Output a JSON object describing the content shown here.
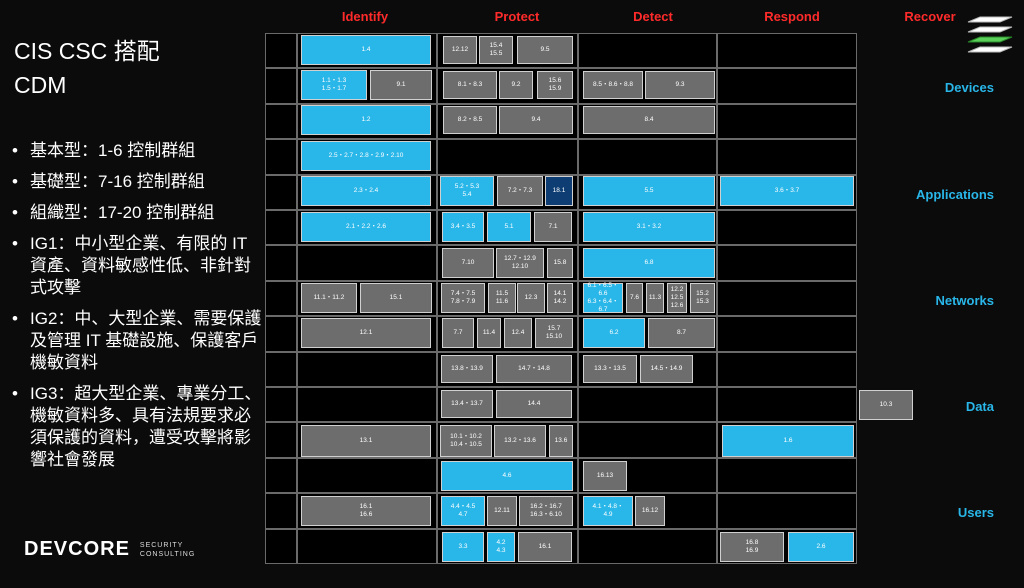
{
  "title": "CIS CSC  搭配\nCDM",
  "bullets": [
    "基本型：1-6 控制群組",
    "基礎型：7-16 控制群組",
    "組織型：17-20 控制群組",
    "IG1：中小型企業、有限的 IT 資產、資料敏感性低、非針對式攻擊",
    "IG2：中、大型企業、需要保護及管理 IT 基礎設施、保護客戶機敏資料",
    "IG3：超大型企業、專業分工、機敏資料多、具有法規要求必須保護的資料，遭受攻擊將影響社會發展"
  ],
  "logo": {
    "name": "DEVCORE",
    "sub": "SECURITY\nCONSULTING"
  },
  "columns": [
    "Identify",
    "Protect",
    "Detect",
    "Respond",
    "Recover"
  ],
  "groups": [
    "Devices",
    "Applications",
    "Networks",
    "Data",
    "Users"
  ],
  "ig_labels": [
    "IG3",
    "IG2",
    "IG1"
  ],
  "colors": {
    "header": "#ff2b2b",
    "group": "#29b6e8",
    "grey": "#6d6d6d",
    "blue": "#29b6e8",
    "dark": "#0d3d73"
  },
  "boxes": [
    {
      "t": "1.4",
      "c": "blue"
    },
    {
      "t": "12.12",
      "c": "grey"
    },
    {
      "t": "15.4\n15.5",
      "c": "grey"
    },
    {
      "t": "9.5",
      "c": "grey"
    },
    {
      "t": "1.1・1.3\n1.5・1.7",
      "c": "blue"
    },
    {
      "t": "9.1",
      "c": "grey"
    },
    {
      "t": "8.1・8.3",
      "c": "grey"
    },
    {
      "t": "9.2",
      "c": "grey"
    },
    {
      "t": "15.6\n15.9",
      "c": "grey"
    },
    {
      "t": "8.5・8.6・8.8",
      "c": "grey"
    },
    {
      "t": "9.3",
      "c": "grey"
    },
    {
      "t": "1.2",
      "c": "blue"
    },
    {
      "t": "8.2・8.5",
      "c": "grey"
    },
    {
      "t": "9.4",
      "c": "grey"
    },
    {
      "t": "8.4",
      "c": "grey"
    },
    {
      "t": "2.5・2.7・2.8・2.9・2.10",
      "c": "blue"
    },
    {
      "t": "2.3・2.4",
      "c": "blue"
    },
    {
      "t": "5.2・5.3\n5.4",
      "c": "blue"
    },
    {
      "t": "7.2・7.3",
      "c": "grey"
    },
    {
      "t": "18.1",
      "c": "dark"
    },
    {
      "t": "5.5",
      "c": "blue"
    },
    {
      "t": "3.6・3.7",
      "c": "blue"
    },
    {
      "t": "2.1・2.2・2.6",
      "c": "blue"
    },
    {
      "t": "3.4・3.5",
      "c": "blue"
    },
    {
      "t": "5.1",
      "c": "blue"
    },
    {
      "t": "7.1",
      "c": "grey"
    },
    {
      "t": "3.1・3.2",
      "c": "blue"
    },
    {
      "t": "7.10",
      "c": "grey"
    },
    {
      "t": "12.7・12.9\n12.10",
      "c": "grey"
    },
    {
      "t": "15.8",
      "c": "grey"
    },
    {
      "t": "6.8",
      "c": "blue"
    },
    {
      "t": "11.1・11.2",
      "c": "grey"
    },
    {
      "t": "15.1",
      "c": "grey"
    },
    {
      "t": "7.4・7.5\n7.8・7.9",
      "c": "grey"
    },
    {
      "t": "11.5\n11.6",
      "c": "grey"
    },
    {
      "t": "12.3",
      "c": "grey"
    },
    {
      "t": "14.1\n14.2",
      "c": "grey"
    },
    {
      "t": "6.1・6.5・6.6\n6.3・6.4・6.7",
      "c": "blue"
    },
    {
      "t": "7.6",
      "c": "grey"
    },
    {
      "t": "11.3",
      "c": "grey"
    },
    {
      "t": "12.2\n12.5\n12.6",
      "c": "grey"
    },
    {
      "t": "15.2\n15.3",
      "c": "grey"
    },
    {
      "t": "12.1",
      "c": "grey"
    },
    {
      "t": "7.7",
      "c": "grey"
    },
    {
      "t": "11.4",
      "c": "grey"
    },
    {
      "t": "12.4",
      "c": "grey"
    },
    {
      "t": "15.7\n15.10",
      "c": "grey"
    },
    {
      "t": "6.2",
      "c": "blue"
    },
    {
      "t": "8.7",
      "c": "grey"
    },
    {
      "t": "13.8・13.9",
      "c": "grey"
    },
    {
      "t": "14.7・14.8",
      "c": "grey"
    },
    {
      "t": "13.3・13.5",
      "c": "grey"
    },
    {
      "t": "14.5・14.9",
      "c": "grey"
    },
    {
      "t": "13.4・13.7",
      "c": "grey"
    },
    {
      "t": "14.4",
      "c": "grey"
    },
    {
      "t": "10.3",
      "c": "grey"
    },
    {
      "t": "13.1",
      "c": "grey"
    },
    {
      "t": "10.1・10.2\n10.4・10.5",
      "c": "grey"
    },
    {
      "t": "13.2・13.6",
      "c": "grey"
    },
    {
      "t": "13.6",
      "c": "grey"
    },
    {
      "t": "1.6",
      "c": "blue"
    },
    {
      "t": "4.6",
      "c": "blue"
    },
    {
      "t": "16.13",
      "c": "grey"
    },
    {
      "t": "16.1\n16.6",
      "c": "grey"
    },
    {
      "t": "4.4・4.5\n4.7",
      "c": "blue"
    },
    {
      "t": "12.11",
      "c": "grey"
    },
    {
      "t": "16.2・16.7\n16.3・6.10",
      "c": "grey"
    },
    {
      "t": "4.1・4.8・\n4.9",
      "c": "blue"
    },
    {
      "t": "16.12",
      "c": "grey"
    },
    {
      "t": "3.3",
      "c": "blue"
    },
    {
      "t": "4.2\n4.3",
      "c": "blue"
    },
    {
      "t": "16.1",
      "c": "grey"
    },
    {
      "t": "16.8\n16.9",
      "c": "grey"
    },
    {
      "t": "2.6",
      "c": "blue"
    }
  ]
}
